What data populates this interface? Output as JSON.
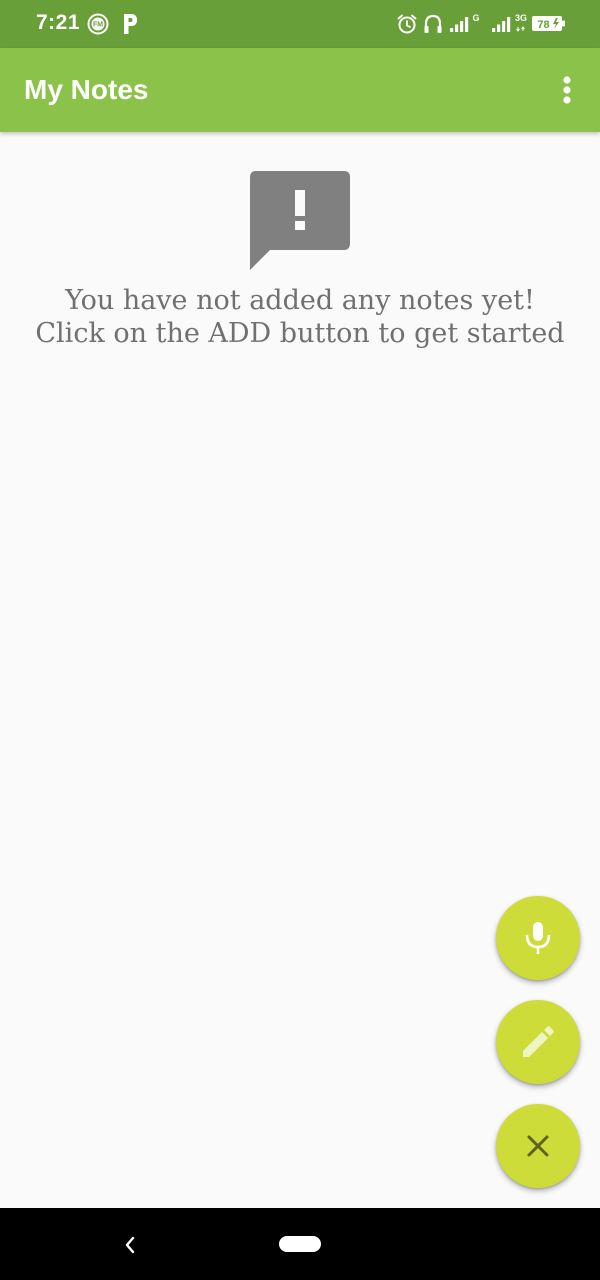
{
  "status_bar": {
    "time": "7:21",
    "icons": [
      "fm-radio-icon",
      "parking-icon",
      "alarm-icon",
      "headset-icon",
      "signal-icon",
      "signal-icon",
      "battery-icon"
    ],
    "network_1": "G",
    "network_2": "3G",
    "battery_level": "78",
    "background_color": "#689f38"
  },
  "app_bar": {
    "title": "My Notes",
    "background_color": "#8bc34a",
    "menu_icon": "more-vert-icon"
  },
  "empty_state": {
    "icon": "feedback-exclamation-icon",
    "line1": "You have not added any notes yet!",
    "line2": "Click on the ADD button to get started"
  },
  "fabs": [
    {
      "name": "voice-note-button",
      "icon": "mic-icon"
    },
    {
      "name": "text-note-button",
      "icon": "pencil-icon"
    },
    {
      "name": "close-menu-button",
      "icon": "close-icon"
    }
  ],
  "fab_color": "#cddc39",
  "nav_bar": {
    "icons": [
      "back-chevron-icon",
      "home-pill-icon"
    ]
  }
}
